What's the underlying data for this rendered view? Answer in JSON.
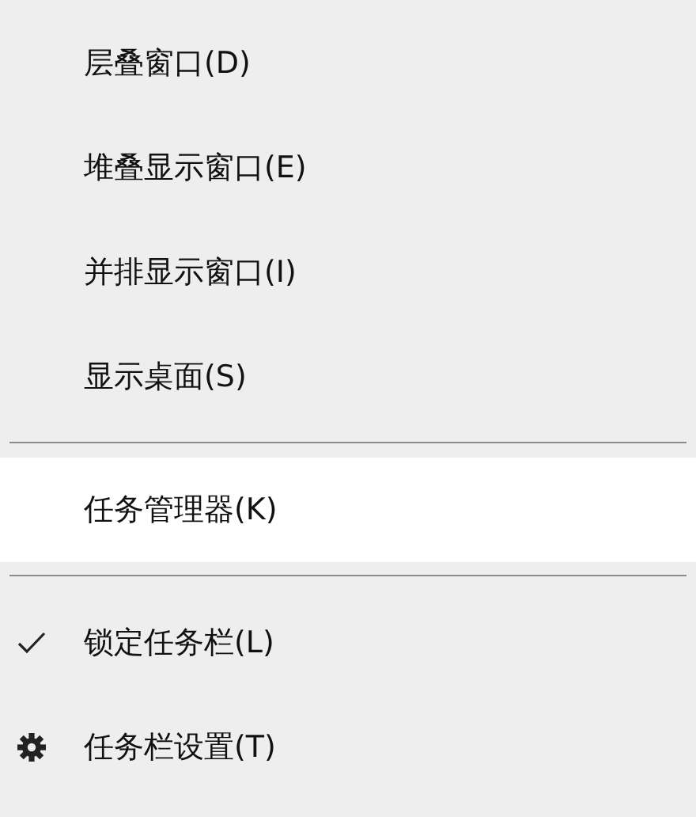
{
  "menu": {
    "groups": [
      {
        "items": [
          {
            "label": "层叠窗口(D)",
            "kind": "plain",
            "selected": false
          },
          {
            "label": "堆叠显示窗口(E)",
            "kind": "plain",
            "selected": false
          },
          {
            "label": "并排显示窗口(I)",
            "kind": "plain",
            "selected": false
          },
          {
            "label": "显示桌面(S)",
            "kind": "plain",
            "selected": false
          }
        ]
      },
      {
        "items": [
          {
            "label": "任务管理器(K)",
            "kind": "plain",
            "selected": true
          }
        ]
      },
      {
        "items": [
          {
            "label": "锁定任务栏(L)",
            "kind": "check",
            "selected": false,
            "checked": true
          },
          {
            "label": "任务栏设置(T)",
            "kind": "settings",
            "selected": false
          }
        ]
      }
    ]
  }
}
